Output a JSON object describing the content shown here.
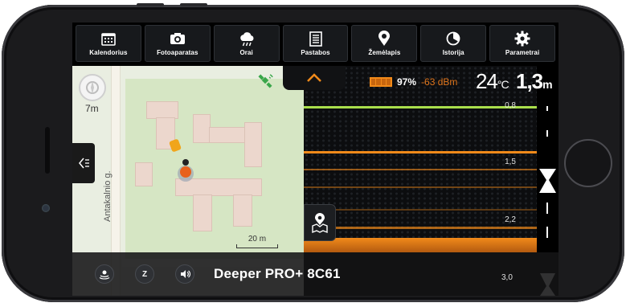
{
  "toolbar": {
    "items": [
      {
        "label": "Kalendorius",
        "icon": "calendar-icon"
      },
      {
        "label": "Fotoaparatas",
        "icon": "camera-icon"
      },
      {
        "label": "Orai",
        "icon": "weather-icon"
      },
      {
        "label": "Pastabos",
        "icon": "notes-icon"
      },
      {
        "label": "Žemėlapis",
        "icon": "map-pin-icon"
      },
      {
        "label": "Istorija",
        "icon": "history-icon"
      },
      {
        "label": "Parametrai",
        "icon": "gear-icon"
      }
    ]
  },
  "map": {
    "street_name": "Antakalnio g.",
    "depth_marker": "7m",
    "scale_label": "20 m"
  },
  "status": {
    "battery_percent": "97%",
    "battery_level": 0.97,
    "signal": "-63 dBm",
    "temperature_value": "24",
    "temperature_unit": "°C",
    "depth_value": "1,3",
    "depth_unit": "m"
  },
  "sonar": {
    "depth_labels": [
      "0,8",
      "1,5",
      "2,2",
      "3,0"
    ]
  },
  "bottombar": {
    "device_name": "Deeper PRO+ 8C61",
    "sleep_label": "Z"
  },
  "colors": {
    "accent_orange": "#f18a1a",
    "sonar_green": "#a9df4c",
    "map_green": "#d6e6c4"
  }
}
